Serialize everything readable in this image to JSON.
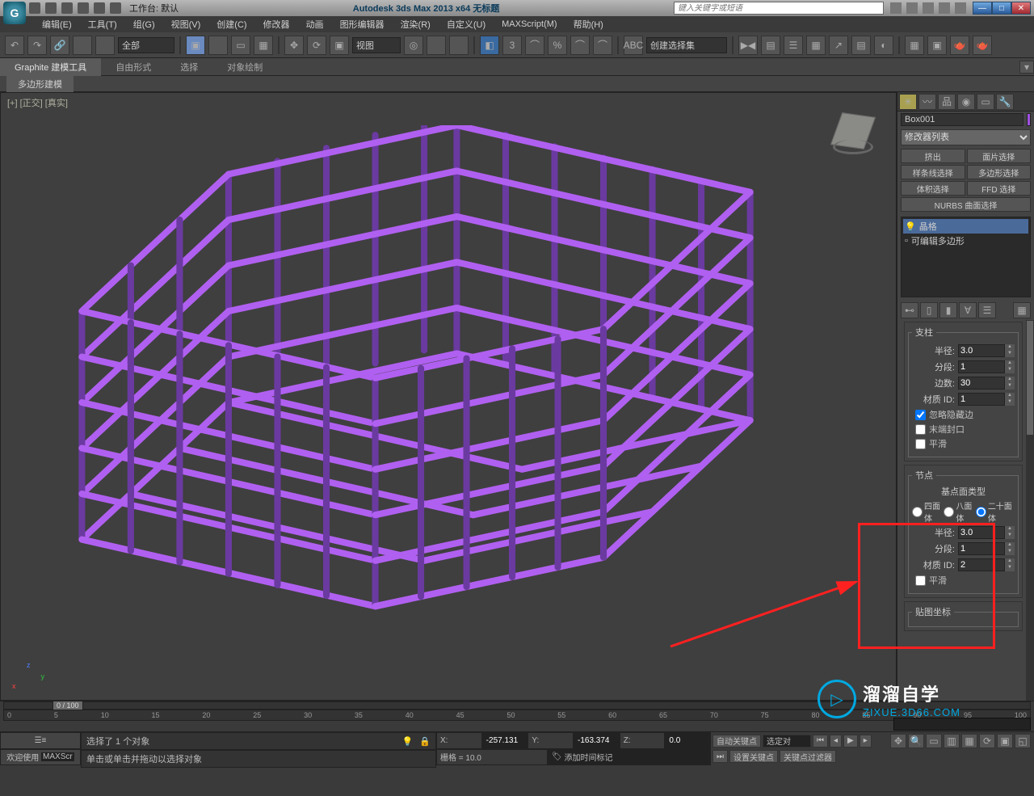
{
  "titlebar": {
    "workspace_label": "工作台: 默认",
    "app_title": "Autodesk 3ds Max  2013 x64    无标题",
    "search_placeholder": "键入关键字或短语"
  },
  "menus": [
    "编辑(E)",
    "工具(T)",
    "组(G)",
    "视图(V)",
    "创建(C)",
    "修改器",
    "动画",
    "图形编辑器",
    "渲染(R)",
    "自定义(U)",
    "MAXScript(M)",
    "帮助(H)"
  ],
  "toolbar": {
    "filter": "全部",
    "view_sel": "视图",
    "named_sel": "创建选择集"
  },
  "ribbon": {
    "tabs": [
      "Graphite 建模工具",
      "自由形式",
      "选择",
      "对象绘制"
    ],
    "sub": "多边形建模"
  },
  "viewport": {
    "label": "[+] [正交] [真实]"
  },
  "sidepanel": {
    "object_name": "Box001",
    "modifier_list": "修改器列表",
    "sel_buttons": [
      "挤出",
      "面片选择",
      "样条线选择",
      "多边形选择",
      "体积选择",
      "FFD 选择",
      "NURBS 曲面选择"
    ],
    "stack": [
      {
        "label": "晶格",
        "sel": true,
        "bulb": true
      },
      {
        "label": "可编辑多边形",
        "sel": false,
        "bulb": false,
        "box": true
      }
    ],
    "struts": {
      "title": "支柱",
      "radius_label": "半径:",
      "radius": "3.0",
      "segments_label": "分段:",
      "segments": "1",
      "sides_label": "边数:",
      "sides": "30",
      "matid_label": "材质 ID:",
      "matid": "1",
      "ignore_hidden": "忽略隐藏边",
      "end_caps": "末端封口",
      "smooth": "平滑"
    },
    "joints": {
      "title": "节点",
      "base_type": "基点面类型",
      "tetra": "四面体",
      "octa": "八面体",
      "icosa": "二十面体",
      "radius_label": "半径:",
      "radius": "3.0",
      "segments_label": "分段:",
      "segments": "1",
      "matid_label": "材质 ID:",
      "matid": "2",
      "smooth": "平滑"
    },
    "map_coords": "贴图坐标"
  },
  "trackbar": {
    "pos": "0 / 100",
    "ticks": [
      "0",
      "5",
      "10",
      "15",
      "20",
      "25",
      "30",
      "35",
      "40",
      "45",
      "50",
      "55",
      "60",
      "65",
      "70",
      "75",
      "80",
      "85",
      "90",
      "95",
      "100"
    ]
  },
  "status": {
    "welcome": "欢迎使用",
    "script": "MAXScr",
    "prompt1": "选择了 1 个对象",
    "prompt2": "单击或单击并拖动以选择对象",
    "x_label": "X:",
    "x": "-257.131",
    "y_label": "Y:",
    "y": "-163.374",
    "z_label": "Z:",
    "z": "0.0",
    "grid": "栅格 = 10.0",
    "addtime": "添加时间标记",
    "autokey": "自动关键点",
    "selset": "选定对",
    "setkey": "设置关键点",
    "keyfilter": "关键点过滤器"
  },
  "watermark": {
    "cn": "溜溜自学",
    "en": "ZIXUE.3D66.COM"
  }
}
